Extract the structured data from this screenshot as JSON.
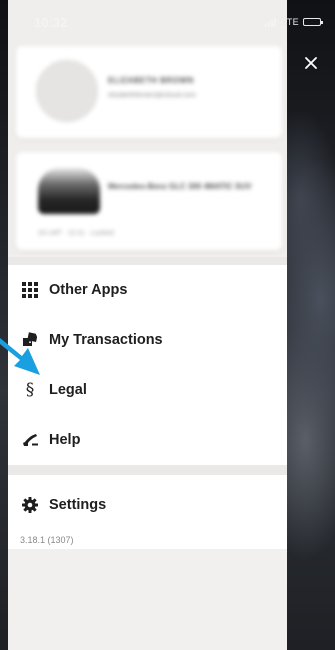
{
  "status_bar": {
    "time": "10:32",
    "network": "LTE"
  },
  "profile": {
    "name": "ELIZABETH BROWN",
    "email": "elizabethbrown@icloud.com"
  },
  "vehicle": {
    "title": "Mercedes-Benz GLC 300 4MATIC SUV",
    "meta": "24 LMT  ·  12:11  ·  Locked"
  },
  "menu": {
    "items": [
      {
        "label": "Other Apps",
        "icon": "grid-icon"
      },
      {
        "label": "My Transactions",
        "icon": "tags-icon"
      },
      {
        "label": "Legal",
        "icon": "section-sign-icon"
      },
      {
        "label": "Help",
        "icon": "phone-icon"
      }
    ]
  },
  "settings": {
    "label": "Settings",
    "icon": "gear-icon",
    "version": "3.18.1 (1307)"
  },
  "colors": {
    "accent_arrow": "#1a9fe0",
    "text": "#1f1f1f",
    "drawer_bg": "#f2f0ef"
  }
}
